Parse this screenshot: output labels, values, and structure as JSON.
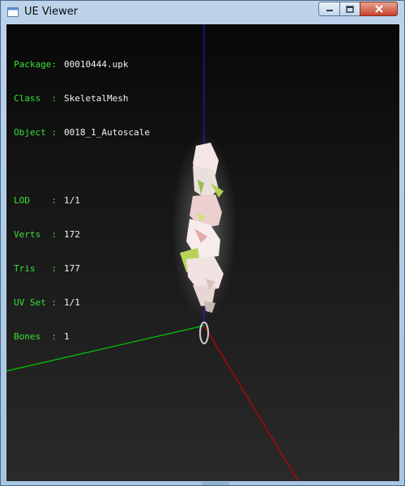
{
  "window": {
    "title": "UE Viewer",
    "icon": "app-window-icon",
    "controls": {
      "minimize": "minimize-icon",
      "maximize": "maximize-icon",
      "close": "close-icon"
    }
  },
  "colors": {
    "label": "#37e337",
    "value": "#f2f2f2",
    "axis_x": "#cc0000",
    "axis_y": "#00cc00",
    "axis_z": "#1a1acc"
  },
  "info": {
    "package_label": "Package:",
    "package": "00010444.upk",
    "class_label": "Class  :",
    "class": "SkeletalMesh",
    "object_label": "Object :",
    "object": "0018_1_Autoscale",
    "lod_label": "LOD    :",
    "lod": "1/1",
    "verts_label": "Verts  :",
    "verts": "172",
    "tris_label": "Tris   :",
    "tris": "177",
    "uvset_label": "UV Set :",
    "uvset": "1/1",
    "bones_label": "Bones  :",
    "bones": "1"
  }
}
